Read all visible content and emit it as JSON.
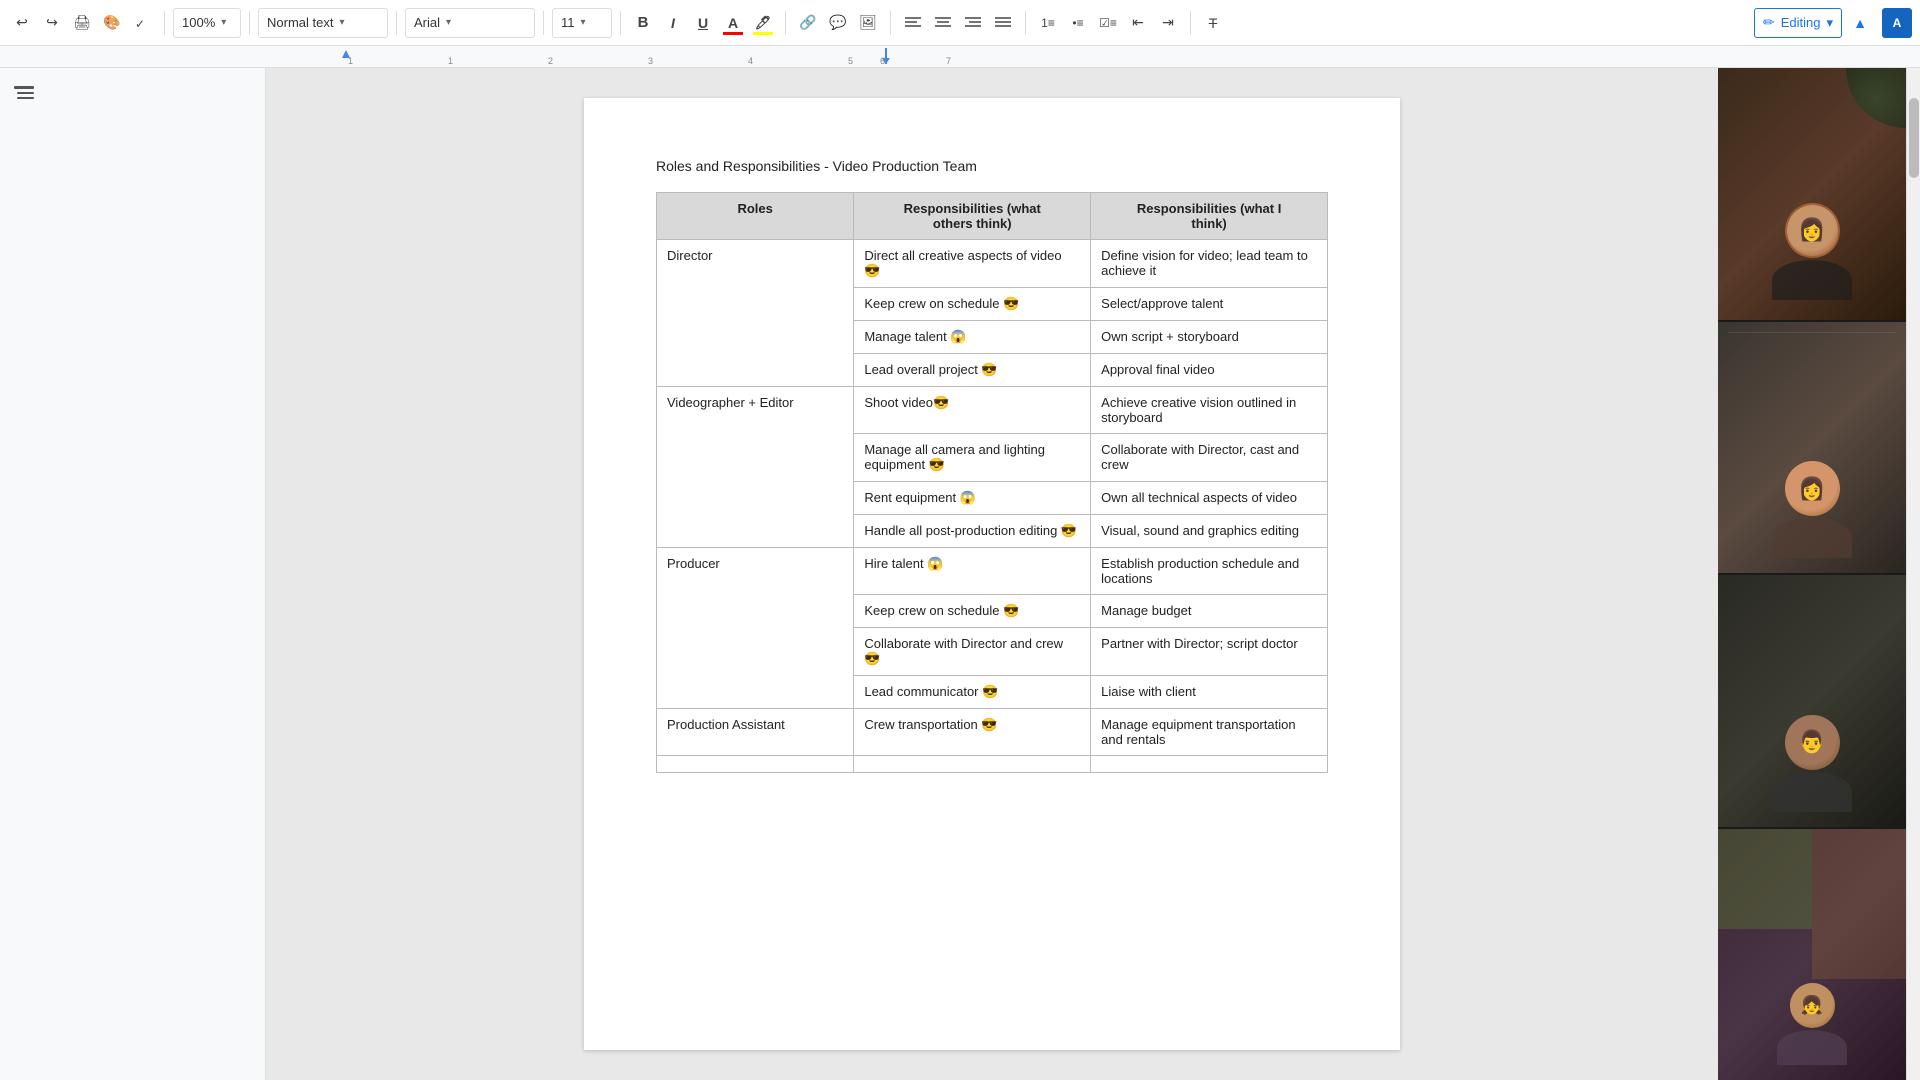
{
  "toolbar": {
    "zoom": "100%",
    "style": "Normal text",
    "font": "Arial",
    "size": "11",
    "editing_label": "Editing",
    "bold": "B",
    "italic": "I",
    "underline": "U"
  },
  "ruler": {
    "marks": [
      "1",
      "",
      "",
      "",
      "1",
      "",
      "2",
      "",
      "3",
      "",
      "4",
      "",
      "5",
      "",
      "6",
      "",
      "7"
    ]
  },
  "document": {
    "title": "Roles and Responsibilities - Video Production Team",
    "table": {
      "headers": [
        "Roles",
        "Responsibilities (what others think)",
        "Responsibilities (what I think)"
      ],
      "rows": [
        {
          "role": "Director",
          "responsibilities_others": [
            "Direct all creative aspects of video 😎",
            "Keep crew on schedule 😎",
            "Manage talent 😱",
            "Lead overall project 😎"
          ],
          "responsibilities_mine": [
            "Define vision for video; lead team to achieve it",
            "Select/approve talent",
            "Own script + storyboard",
            "Approval final video"
          ]
        },
        {
          "role": "Videographer + Editor",
          "responsibilities_others": [
            "Shoot video😎",
            "Manage all camera and lighting equipment 😎",
            "Rent equipment 😱",
            "Handle all post-production editing 😎"
          ],
          "responsibilities_mine": [
            "Achieve creative vision outlined in storyboard",
            "Collaborate with Director, cast and crew",
            "Own all technical aspects of video",
            "Visual, sound and graphics editing"
          ]
        },
        {
          "role": "Producer",
          "responsibilities_others": [
            "Hire talent 😱",
            "Keep crew on schedule 😎",
            "Collaborate with Director and crew 😎",
            "Lead communicator 😎"
          ],
          "responsibilities_mine": [
            "Establish production schedule and locations",
            "Manage budget",
            "Partner with Director; script doctor",
            "Liaise with client"
          ]
        },
        {
          "role": "Production Assistant",
          "responsibilities_others": [
            "Crew transportation 😎"
          ],
          "responsibilities_mine": [
            "Manage equipment transportation and rentals"
          ]
        }
      ]
    }
  },
  "video_panel": {
    "tiles": [
      {
        "id": "tile1",
        "label": ""
      },
      {
        "id": "tile2",
        "label": ""
      },
      {
        "id": "tile3",
        "label": ""
      },
      {
        "id": "tile4",
        "label": ""
      }
    ]
  },
  "icons": {
    "undo": "↩",
    "redo": "↪",
    "print": "🖨",
    "paint_format": "🎨",
    "spell_check": "✓",
    "bold": "B",
    "italic": "I",
    "underline": "U",
    "link": "🔗",
    "image": "🖼",
    "align_left": "≡",
    "pencil": "✏",
    "chevron_up": "▲",
    "outline": "☰",
    "more_vert": "⋮"
  }
}
